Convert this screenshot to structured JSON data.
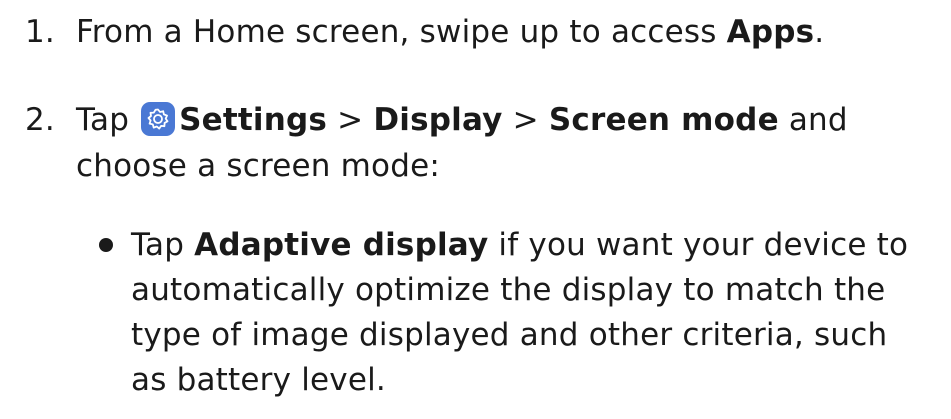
{
  "steps": [
    {
      "number": "1.",
      "before": "From a Home screen, swipe up to access ",
      "bold": "Apps",
      "after": "."
    },
    {
      "number": "2.",
      "tap": "Tap ",
      "settings": "Settings",
      "sep1": " > ",
      "display": "Display",
      "sep2": " > ",
      "screen_mode": "Screen mode",
      "and": " and",
      "line2": "choose a screen mode:",
      "icon": "settings-gear-icon",
      "icon_color": "#4a78d4"
    }
  ],
  "bullet": {
    "tap": "Tap ",
    "bold": "Adaptive display",
    "line1_rest": " if you want your device to",
    "line2": "automatically optimize the display to match the",
    "line3": "type of image displayed and other criteria, such",
    "line4": "as battery level."
  }
}
